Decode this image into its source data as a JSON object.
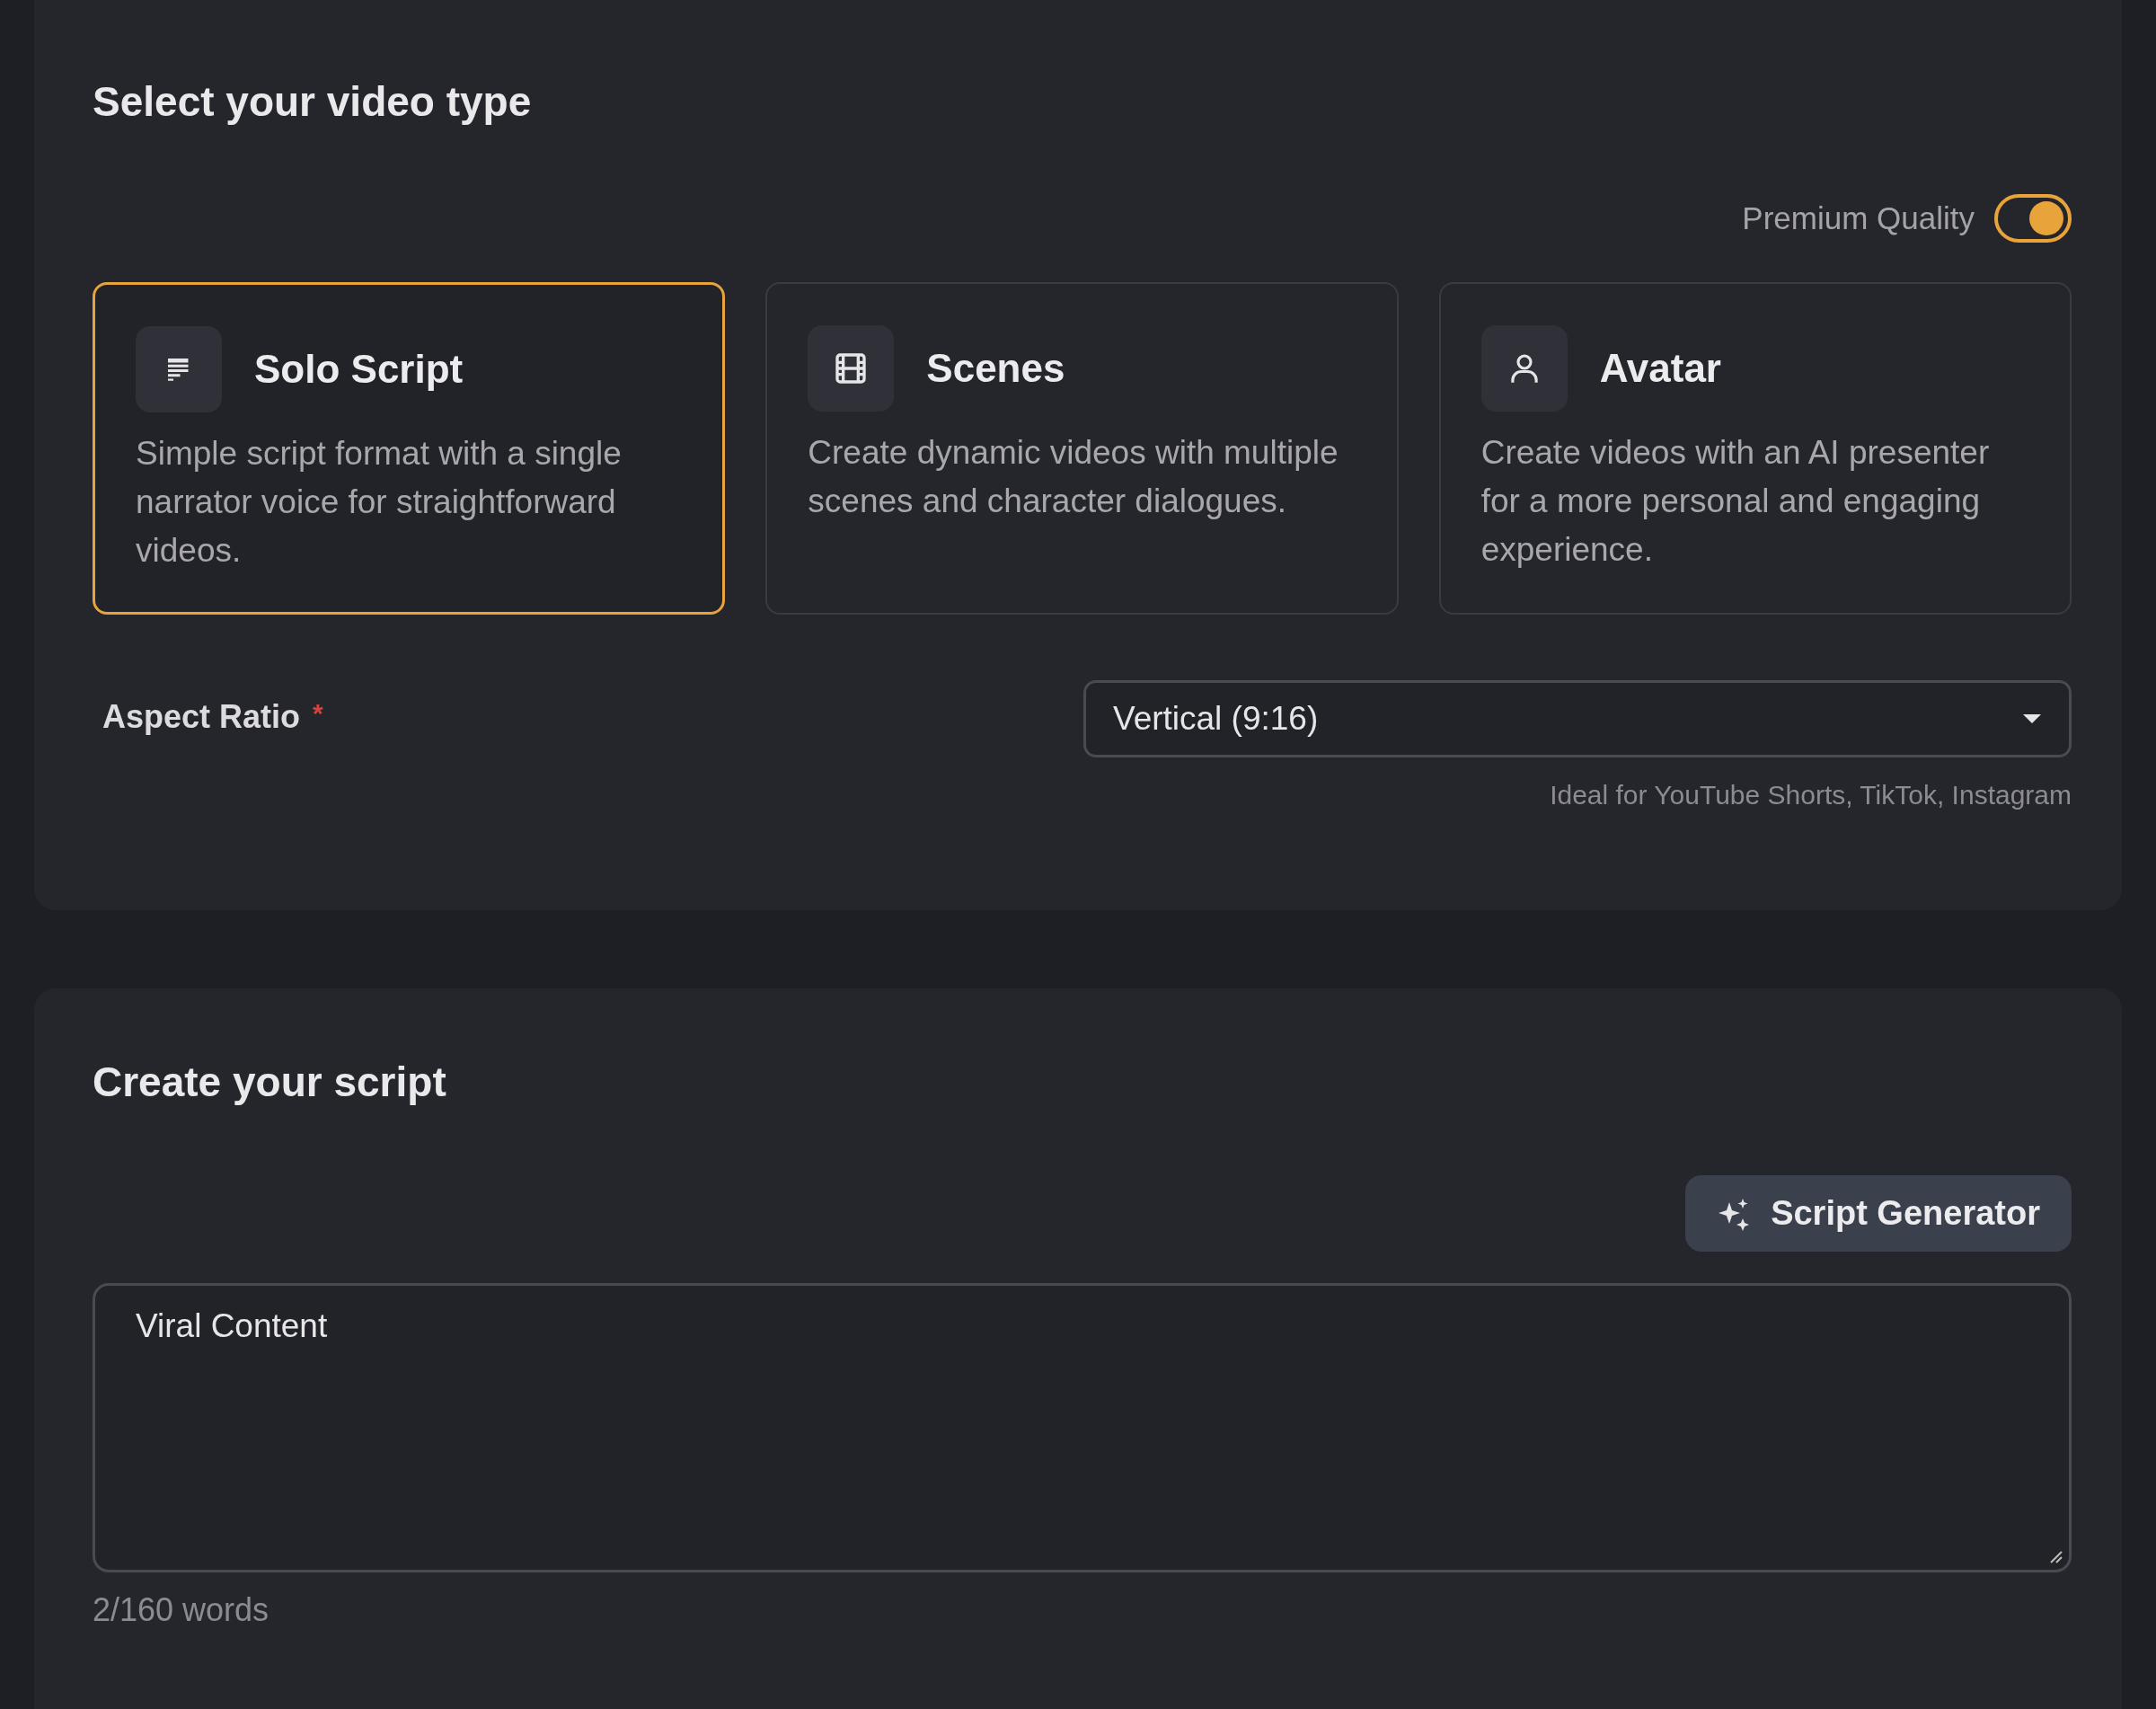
{
  "video_type": {
    "title": "Select your video type",
    "premium_quality": {
      "label": "Premium Quality",
      "on": true
    },
    "types": [
      {
        "kind": "script",
        "title": "Solo Script",
        "description": "Simple script format with a single narrator voice for straightforward videos.",
        "selected": true
      },
      {
        "kind": "scenes",
        "title": "Scenes",
        "description": "Create dynamic videos with multiple scenes and character dialogues.",
        "selected": false
      },
      {
        "kind": "avatar",
        "title": "Avatar",
        "description": "Create videos with an AI presenter for a more personal and engaging experience.",
        "selected": false
      }
    ],
    "aspect_ratio": {
      "label": "Aspect Ratio",
      "required_mark": "*",
      "value": "Vertical (9:16)",
      "hint": "Ideal for YouTube Shorts, TikTok, Instagram"
    }
  },
  "script": {
    "title": "Create your script",
    "generator_button": "Script Generator",
    "value": "Viral Content",
    "word_count": "2/160 words"
  }
}
